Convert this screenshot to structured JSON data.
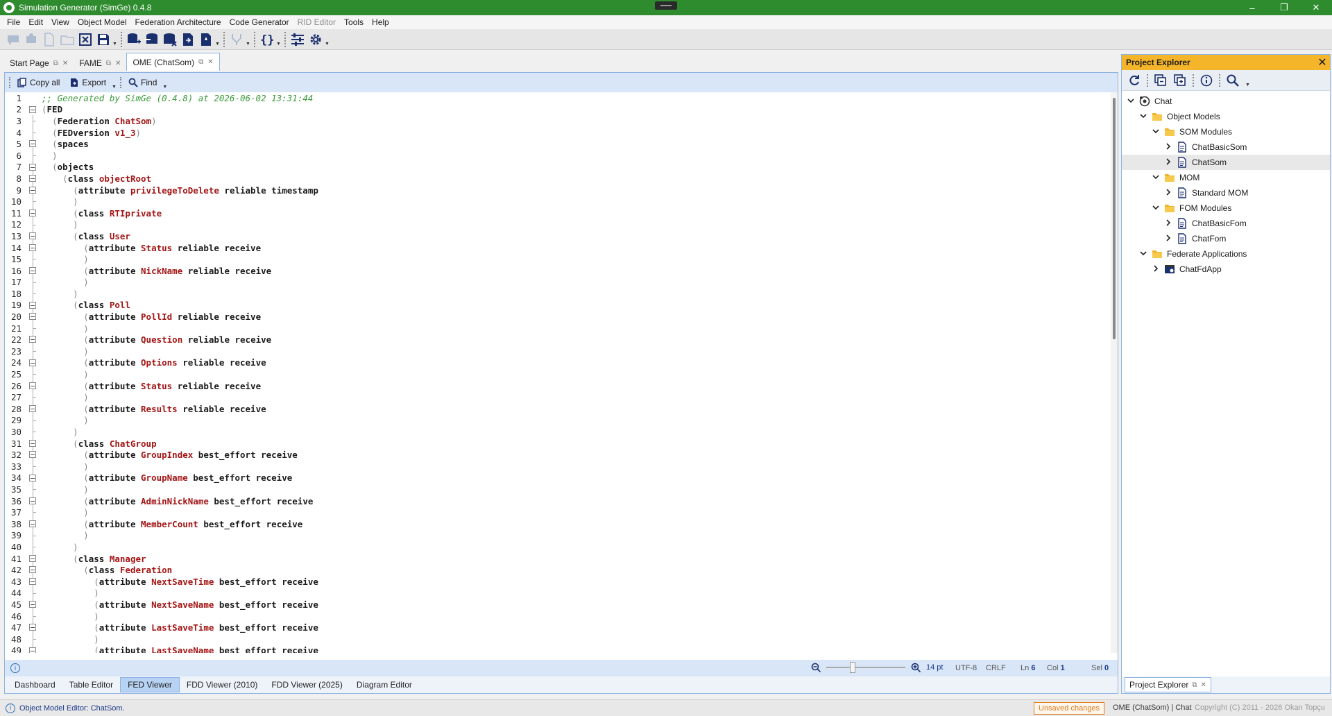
{
  "window": {
    "title": "Simulation Generator (SimGe) 0.4.8",
    "controls": [
      "–",
      "❐",
      "✕"
    ]
  },
  "menu": [
    "File",
    "Edit",
    "View",
    "Object Model",
    "Federation Architecture",
    "Code Generator",
    "RID Editor",
    "Tools",
    "Help"
  ],
  "doc_tabs": [
    {
      "label": "Start Page"
    },
    {
      "label": "FAME"
    },
    {
      "label": "OME (ChatSom)"
    }
  ],
  "editor_toolbar": {
    "copy_all": "Copy all",
    "export": "Export",
    "find": "Find"
  },
  "code_lines": [
    ";; Generated by SimGe (0.4.8) at 2026-06-02 13:31:44",
    "(FED",
    "  (Federation ChatSom)",
    "  (FEDversion v1_3)",
    "  (spaces",
    "  )",
    "  (objects",
    "    (class objectRoot",
    "      (attribute privilegeToDelete reliable timestamp",
    "      )",
    "      (class RTIprivate",
    "      )",
    "      (class User",
    "        (attribute Status reliable receive",
    "        )",
    "        (attribute NickName reliable receive",
    "        )",
    "      )",
    "      (class Poll",
    "        (attribute PollId reliable receive",
    "        )",
    "        (attribute Question reliable receive",
    "        )",
    "        (attribute Options reliable receive",
    "        )",
    "        (attribute Status reliable receive",
    "        )",
    "        (attribute Results reliable receive",
    "        )",
    "      )",
    "      (class ChatGroup",
    "        (attribute GroupIndex best_effort receive",
    "        )",
    "        (attribute GroupName best_effort receive",
    "        )",
    "        (attribute AdminNickName best_effort receive",
    "        )",
    "        (attribute MemberCount best_effort receive",
    "        )",
    "      )",
    "      (class Manager",
    "        (class Federation",
    "          (attribute NextSaveTime best_effort receive",
    "          )",
    "          (attribute NextSaveName best_effort receive",
    "          )",
    "          (attribute LastSaveTime best_effort receive",
    "          )",
    "          (attribute LastSaveName best_effort receive"
  ],
  "editor_status": {
    "zoom": "14 pt",
    "encoding": "UTF-8",
    "eol": "CRLF",
    "ln_label": "Ln",
    "ln": "6",
    "col_label": "Col",
    "col": "1",
    "sel_label": "Sel",
    "sel": "0"
  },
  "view_tabs": [
    "Dashboard",
    "Table Editor",
    "FED Viewer",
    "FDD Viewer (2010)",
    "FDD Viewer (2025)",
    "Diagram Editor"
  ],
  "project_explorer": {
    "title": "Project Explorer",
    "tree": [
      {
        "label": "Chat",
        "depth": 0,
        "icon": "project-icon",
        "expanded": true
      },
      {
        "label": "Object Models",
        "depth": 1,
        "icon": "folder-icon",
        "expanded": true
      },
      {
        "label": "SOM Modules",
        "depth": 2,
        "icon": "folder-icon",
        "expanded": true
      },
      {
        "label": "ChatBasicSom",
        "depth": 3,
        "icon": "document-icon",
        "expanded": false
      },
      {
        "label": "ChatSom",
        "depth": 3,
        "icon": "document-icon",
        "expanded": false,
        "selected": true
      },
      {
        "label": "MOM",
        "depth": 2,
        "icon": "folder-icon",
        "expanded": true
      },
      {
        "label": "Standard MOM",
        "depth": 3,
        "icon": "document-icon",
        "expanded": false
      },
      {
        "label": "FOM Modules",
        "depth": 2,
        "icon": "folder-icon",
        "expanded": true
      },
      {
        "label": "ChatBasicFom",
        "depth": 3,
        "icon": "document-icon",
        "expanded": false
      },
      {
        "label": "ChatFom",
        "depth": 3,
        "icon": "document-icon",
        "expanded": false
      },
      {
        "label": "Federate Applications",
        "depth": 1,
        "icon": "folder-icon",
        "expanded": true
      },
      {
        "label": "ChatFdApp",
        "depth": 2,
        "icon": "app-icon",
        "expanded": false
      }
    ],
    "bottom_tab": "Project Explorer"
  },
  "statusbar": {
    "message": "Object Model Editor: ChatSom.",
    "unsaved": "Unsaved changes",
    "context": "OME (ChatSom) | Chat",
    "copyright": "Copyright (C) 2011 - 2026 Okan Topçu"
  },
  "colors": {
    "title_green": "#2e8b2e",
    "accent_blue": "#8fb4e3",
    "explorer_header": "#f5b52a",
    "keyword_name": "#a31515",
    "comment": "#3d9a3d"
  }
}
